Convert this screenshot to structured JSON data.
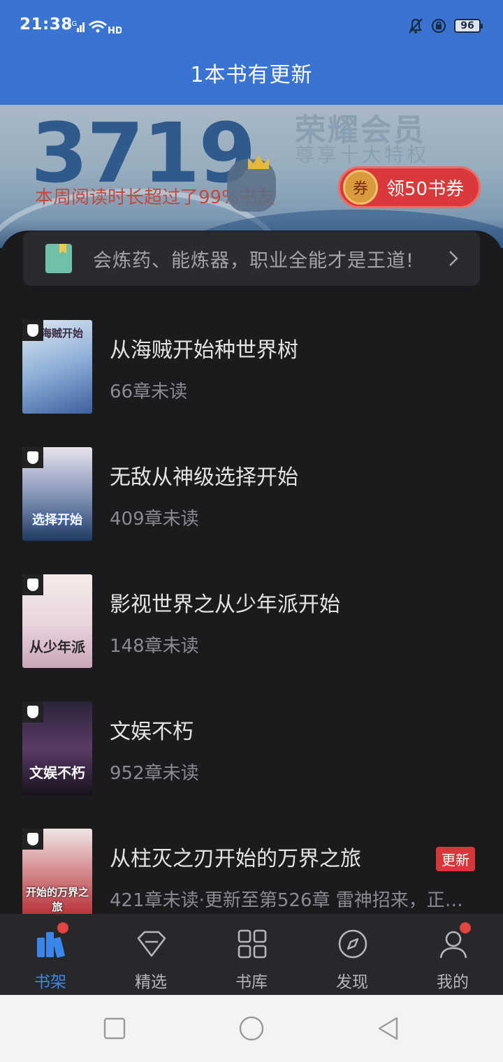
{
  "status_bar": {
    "time": "21:38",
    "network": "4G",
    "battery": "96"
  },
  "header": {
    "title": "1本书有更新"
  },
  "banner": {
    "reading_count": "3719",
    "reading_desc": "本周阅读时长超过了99%书友",
    "vip_title": "荣耀会员",
    "vip_subtitle": "尊享十大特权",
    "coupon_icon_text": "券",
    "coupon_label": "领50书券"
  },
  "notice": {
    "text": "会炼药、能炼器，职业全能才是王道!"
  },
  "books": [
    {
      "title": "从海贼开始种世界树",
      "sub": "66章未读",
      "cover_text": "海贼开始",
      "cover_colors": [
        "#dfe8f2",
        "#3d5f9e"
      ]
    },
    {
      "title": "无敌从神级选择开始",
      "sub": "409章未读",
      "cover_text": "选择开始",
      "cover_colors": [
        "#e8e3ea",
        "#1f3a63"
      ]
    },
    {
      "title": "影视世界之从少年派开始",
      "sub": "148章未读",
      "cover_text": "从少年派",
      "cover_colors": [
        "#f4ece8",
        "#c9a6b8"
      ]
    },
    {
      "title": "文娱不朽",
      "sub": "952章未读",
      "cover_text": "文娱不朽",
      "cover_colors": [
        "#2a2438",
        "#5a3c66"
      ]
    },
    {
      "title": "从柱灭之刃开始的万界之旅",
      "sub": "421章未读·更新至第526章 雷神招来，正…",
      "cover_text": "开始的万界之旅",
      "cover_colors": [
        "#efe6e6",
        "#b2242b"
      ],
      "badge": "更新"
    }
  ],
  "bottom_nav": [
    {
      "label": "书架",
      "icon": "bookshelf-icon",
      "active": true,
      "dot": true
    },
    {
      "label": "精选",
      "icon": "diamond-icon",
      "active": false,
      "dot": false
    },
    {
      "label": "书库",
      "icon": "grid-icon",
      "active": false,
      "dot": false
    },
    {
      "label": "发现",
      "icon": "compass-icon",
      "active": false,
      "dot": false
    },
    {
      "label": "我的",
      "icon": "profile-icon",
      "active": false,
      "dot": true
    }
  ],
  "colors": {
    "header_blue": "#3a74d2",
    "accent_blue": "#3b86e9",
    "badge_red": "#d6373b",
    "background": "#1b1b1d"
  }
}
